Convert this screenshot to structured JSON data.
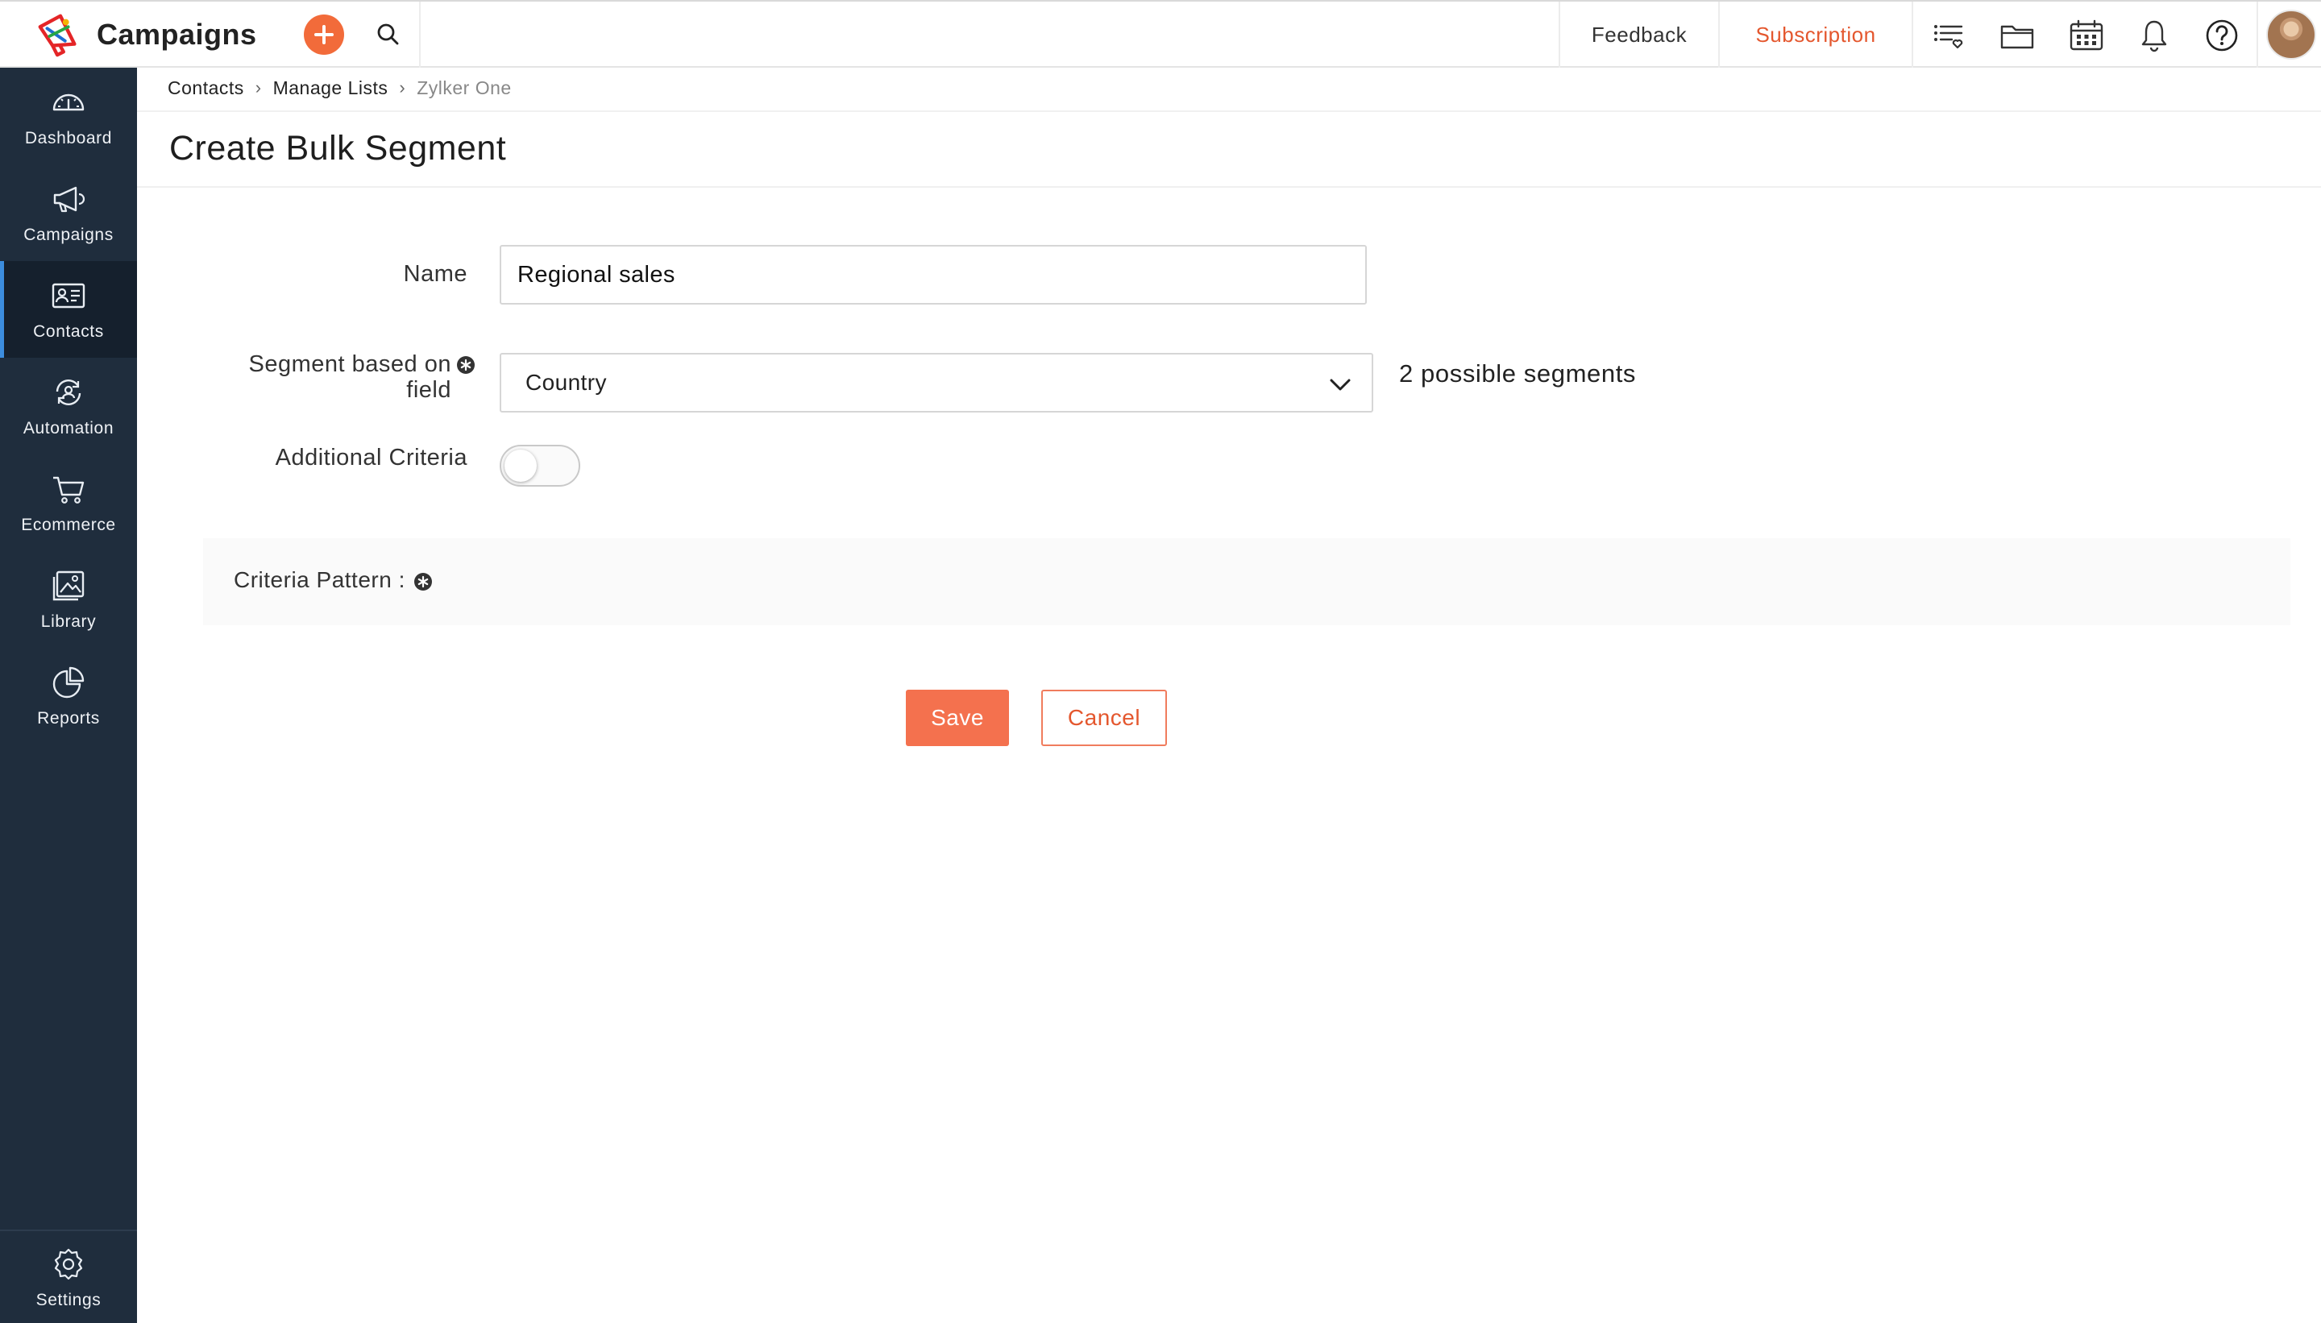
{
  "app": {
    "name": "Campaigns",
    "logo_icon": "megaphone-logo-icon",
    "accent_color": "#f26b3a",
    "sidebar_color": "#1f2d3d"
  },
  "topbar": {
    "add_icon": "plus-icon",
    "search_icon": "search-icon",
    "feedback_label": "Feedback",
    "subscription_label": "Subscription",
    "icons": [
      "list-heart-icon",
      "folder-icon",
      "calendar-icon",
      "bell-icon",
      "help-icon",
      "avatar"
    ]
  },
  "sidebar": {
    "items": [
      {
        "label": "Dashboard",
        "icon": "gauge-icon",
        "active": false
      },
      {
        "label": "Campaigns",
        "icon": "megaphone-icon",
        "active": false
      },
      {
        "label": "Contacts",
        "icon": "contact-card-icon",
        "active": true
      },
      {
        "label": "Automation",
        "icon": "automation-icon",
        "active": false
      },
      {
        "label": "Ecommerce",
        "icon": "cart-icon",
        "active": false
      },
      {
        "label": "Library",
        "icon": "image-library-icon",
        "active": false
      },
      {
        "label": "Reports",
        "icon": "pie-chart-icon",
        "active": false
      }
    ],
    "settings": {
      "label": "Settings",
      "icon": "gear-icon"
    }
  },
  "breadcrumb": [
    "Contacts",
    "Manage Lists",
    "Zylker One"
  ],
  "page": {
    "title": "Create Bulk Segment"
  },
  "form": {
    "name_label": "Name",
    "name_value": "Regional sales",
    "segment_label_line1": "Segment based on",
    "segment_label_line2": "field",
    "segment_value": "Country",
    "possible_segments": "2 possible segments",
    "additional_label": "Additional Criteria",
    "additional_enabled": false,
    "criteria_label": "Criteria Pattern :"
  },
  "actions": {
    "save_label": "Save",
    "cancel_label": "Cancel"
  }
}
